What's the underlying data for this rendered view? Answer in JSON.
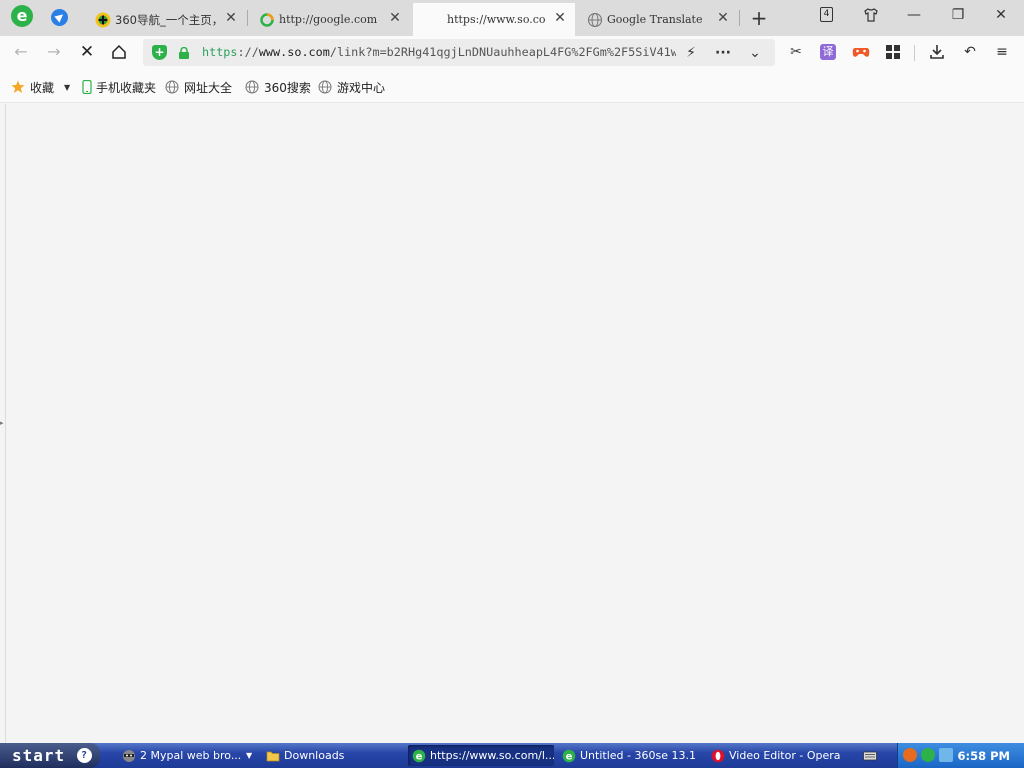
{
  "browser": {
    "tabs": [
      {
        "title": "360导航_一个主页，",
        "active": false,
        "icon": "360-nav-icon"
      },
      {
        "title": "http://google.com",
        "active": false,
        "icon": "loading-ring-icon"
      },
      {
        "title": "https://www.so.co",
        "active": true,
        "icon": "blank-page-icon"
      },
      {
        "title": "Google Translate",
        "active": false,
        "icon": "globe-icon"
      }
    ],
    "tab_count": "4",
    "address": {
      "scheme": "https",
      "sep": "://",
      "host": "www.so.com",
      "path": "/link?m=b2RHg41qgjLnDNUauhheapL4FG%2FGm%2F5SiV41w"
    },
    "bookmarks": [
      {
        "label": "收藏",
        "icon": "star-icon"
      },
      {
        "label": "手机收藏夹",
        "icon": "phone-icon"
      },
      {
        "label": "网址大全",
        "icon": "globe-icon"
      },
      {
        "label": "360搜索",
        "icon": "globe-icon"
      },
      {
        "label": "游戏中心",
        "icon": "globe-icon"
      }
    ],
    "translate_badge": "译"
  },
  "taskbar": {
    "start_label": "start",
    "tasks": [
      {
        "label": "2 Mypal web bro...",
        "icon": "raccoon-icon",
        "active": false
      },
      {
        "label": "Downloads",
        "icon": "folder-icon",
        "active": false
      },
      {
        "label": "https://www.so.com/l...",
        "icon": "360se-icon",
        "active": true
      },
      {
        "label": "Untitled - 360se 13.1",
        "icon": "360se-icon",
        "active": false
      },
      {
        "label": "Video Editor - Opera",
        "icon": "opera-icon",
        "active": false
      }
    ],
    "clock": "6:58 PM"
  },
  "colors": {
    "accent_green": "#2ca15a",
    "taskbar_blue": "#2846a8",
    "tray_blue": "#1a66c6"
  }
}
